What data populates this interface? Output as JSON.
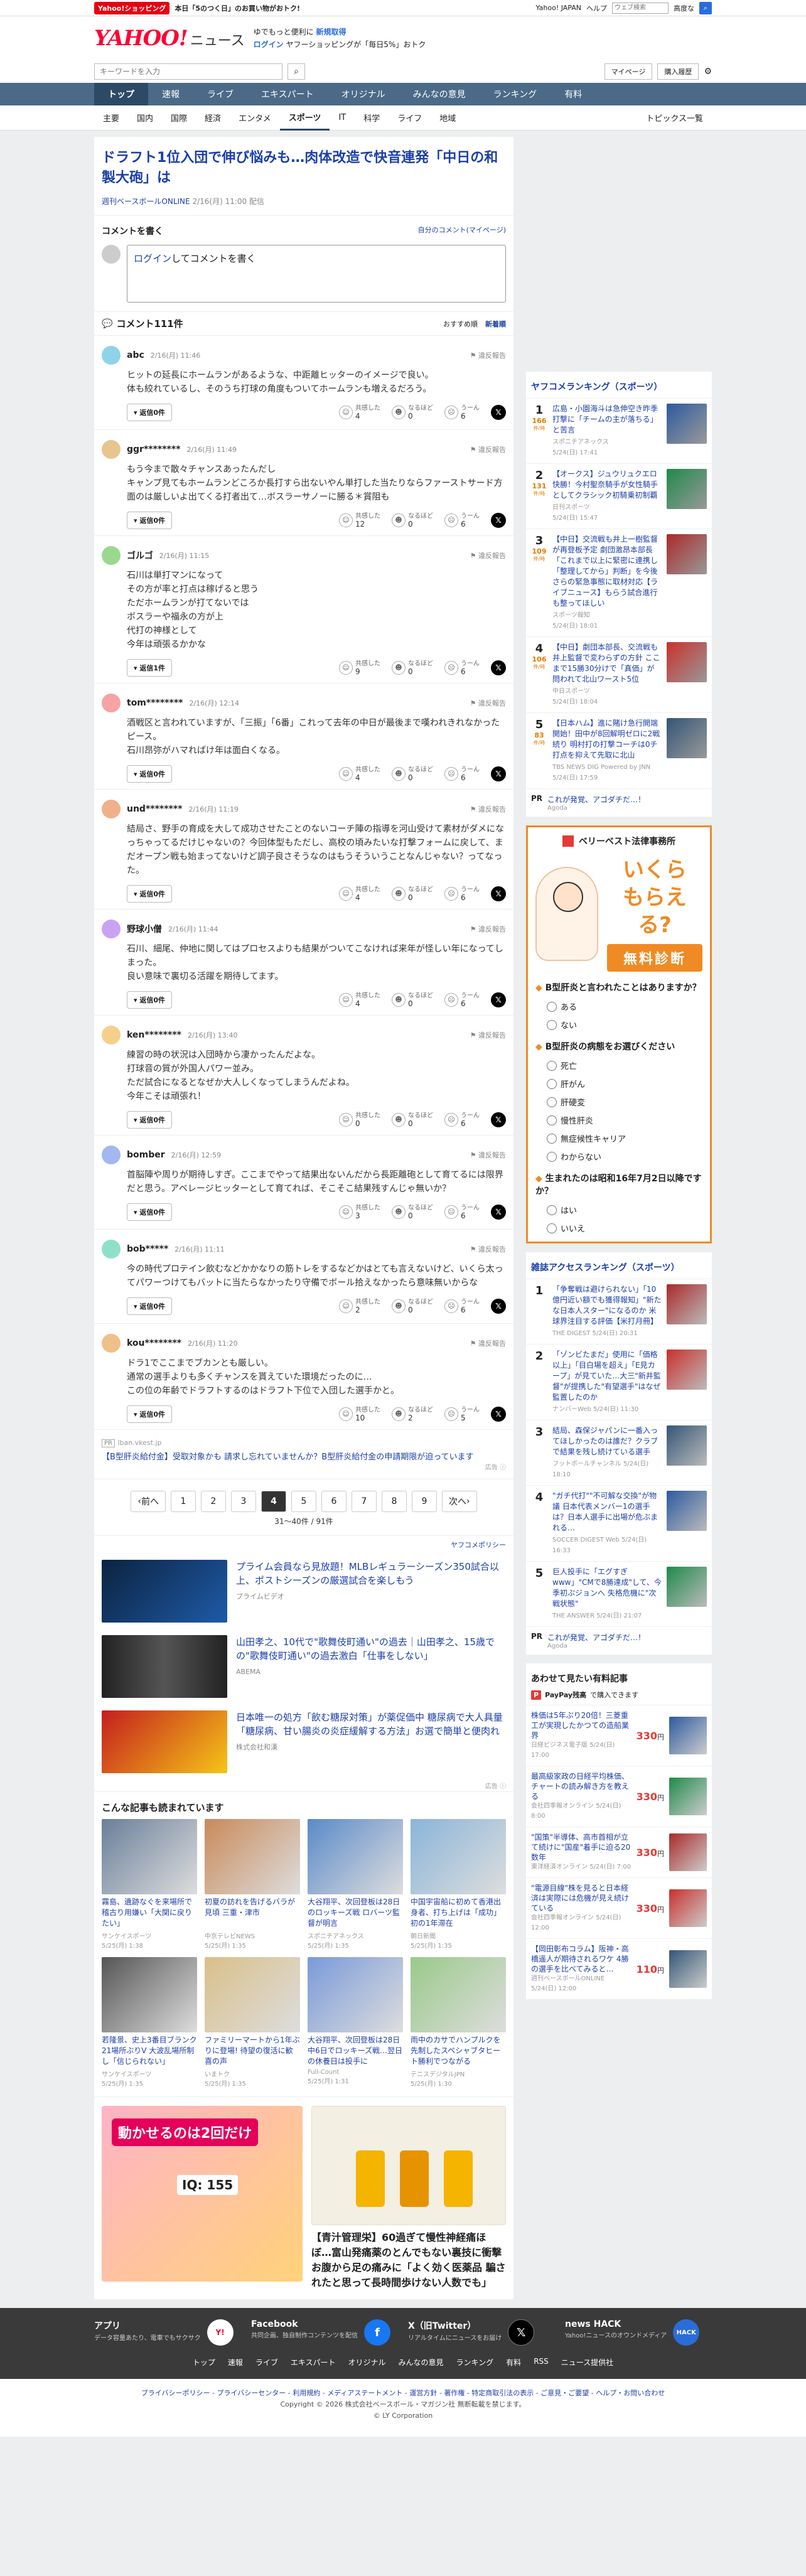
{
  "topbar": {
    "shop": "Yahoo!ショッピング",
    "promo": "本日「5のつく日」のお買い物がおトク!",
    "yjapan": "Yahoo! JAPAN",
    "help": "ヘルプ",
    "search_placeholder": "ウェブ検索",
    "adv": "高度な"
  },
  "brand": {
    "logo": "YAHOO!",
    "sub": "ニュース",
    "promo_line1": "ゆでもっと便利に",
    "new_reg": "新規取得",
    "login": "ログイン",
    "promo_line2": "ヤフーショッピングが「毎日5%」おトク"
  },
  "search": {
    "placeholder": "キーワードを入力",
    "mypage": "マイページ",
    "subscribe": "購入履歴"
  },
  "gnav": [
    "トップ",
    "速報",
    "ライブ",
    "エキスパート",
    "オリジナル",
    "みんなの意見",
    "ランキング",
    "有料"
  ],
  "snav": [
    "主要",
    "国内",
    "国際",
    "経済",
    "エンタメ",
    "スポーツ",
    "IT",
    "科学",
    "ライフ",
    "地域"
  ],
  "snav_right": "トピックス一覧",
  "article": {
    "title": "ドラフト1位入団で伸び悩みも…肉体改造で快音連発「中日の和製大砲」は",
    "source": "週刊ベースボールONLINE",
    "date": "2/16(月) 11:00",
    "delivered": "配信"
  },
  "comment_box": {
    "heading": "コメントを書く",
    "my_comments": "自分のコメント(マイページ)",
    "login": "ログイン",
    "prompt": "してコメントを書く"
  },
  "comments_head": {
    "title": "コメント111件",
    "sort1": "おすすめ順",
    "sort2": "新着順"
  },
  "reaction_labels": [
    "共感した",
    "なるほど",
    "うーん"
  ],
  "reply_suffix": "返信",
  "report": "違反報告",
  "comments": [
    {
      "user": "abc",
      "date": "2/16(月) 11:46",
      "body": "ヒットの延長にホームランがあるような、中距離ヒッターのイメージで良い。\n体も絞れているし、そのうち打球の角度もついてホームランも増えるだろう。",
      "replies": "返信0件",
      "r": [
        4,
        0,
        6
      ]
    },
    {
      "user": "ggr********",
      "date": "2/16(月) 11:49",
      "body": "もう今まで散々チャンスあったんだし\nキャンプ見てもホームランどころか長打すら出ないやん単打した当たりならファーストサード方面のは厳しいよ出てくる打者出て…ボスラーサノーに勝る＊賞阻も",
      "replies": "返信0件",
      "r": [
        12,
        0,
        6
      ]
    },
    {
      "user": "ゴルゴ",
      "date": "2/16(月) 11:15",
      "body": "石川は単打マンになって\nその方が率と打点は稼げると思う\nただホームランが打てないでは\nボスラーや福永の方が上\n代打の神様として\n今年は頑張るかかな",
      "replies": "返信1件",
      "r": [
        9,
        0,
        6
      ]
    },
    {
      "user": "tom********",
      "date": "2/16(月) 12:14",
      "body": "酒戦区と言われていますが、「三振」「6番」これって去年の中日が最後まで嘆われきれなかったピース。\n石川昂弥がハマればけ年は面白くなる。",
      "replies": "返信0件",
      "r": [
        4,
        0,
        6
      ]
    },
    {
      "user": "und********",
      "date": "2/16(月) 11:19",
      "body": "結局さ、野手の育成を大して成功させたことのないコーチ陣の指導を河山受けて素材がダメになっちゃってるだけじゃないの？今回体型もただし、高校の頃みたいな打撃フォームに戻して、まだオープン戦も始まってないけど調子良さそうなのはもうそういうことなんじゃない？ってなった。",
      "replies": "返信0件",
      "r": [
        4,
        0,
        6
      ]
    },
    {
      "user": "野球小僧",
      "date": "2/16(月) 11:44",
      "body": "石川、細尾、仲地に関してはプロセスよりも結果がついてこなければ来年が怪しい年になってしまった。\n良い意味で裏切る活躍を期待してます。",
      "replies": "返信0件",
      "r": [
        4,
        0,
        6
      ]
    },
    {
      "user": "ken********",
      "date": "2/16(月) 13:40",
      "body": "練習の時の状況は入団時から凄かったんだよな。\n打球音の質が外国人パワー並み。\nただ試合になるとなぜか大人しくなってしまうんだよね。\n今年こそは頑張れ！",
      "replies": "返信0件",
      "r": [
        0,
        0,
        6
      ]
    },
    {
      "user": "bomber",
      "date": "2/16(月) 12:59",
      "body": "首脳陣や周りが期待しすぎ。ここまでやって結果出ないんだから長距離砲として育てるには限界だと思う。アベレージヒッターとして育てれば、そこそこ結果残すんじゃ無いか？",
      "replies": "返信0件",
      "r": [
        3,
        0,
        6
      ]
    },
    {
      "user": "bob*****",
      "date": "2/16(月) 11:11",
      "body": "今の時代プロテイン飲むなどかかなりの筋トレをするなどかはとても言えないけど、いくら太ってパワーつけてもバットに当たらなかったり守備でボール拾えなかったら意味無いからな",
      "replies": "返信0件",
      "r": [
        2,
        0,
        6
      ]
    },
    {
      "user": "kou********",
      "date": "2/16(月) 11:20",
      "body": "ドラ1でここまでブカンとも厳しい。\n通常の選手よりも多くチャンスを貰えていた環境だったのに…\nこの位の年齢でドラフトするのはドラフト下位で入団した選手かと。",
      "replies": "返信0件",
      "r": [
        10,
        2,
        5
      ]
    }
  ],
  "ad_line": {
    "src": "lban.vkest.jp",
    "text": "【B型肝炎給付金】受取対象かも 請求し忘れていませんか？B型肝炎給付金の申請期限が迫っています",
    "pr": "広告"
  },
  "pager": {
    "prev": "前へ",
    "next": "次へ",
    "pages": [
      "1",
      "2",
      "3",
      "4",
      "5",
      "6",
      "7",
      "8",
      "9"
    ],
    "current": "4",
    "count": "31〜40件 / 91件"
  },
  "policy": "ヤフコメポリシー",
  "promos": [
    {
      "title": "プライム会員なら見放題！MLBレギュラーシーズン350試合以上、ポストシーズンの厳選試合を楽しもう",
      "src": "プライムビデオ"
    },
    {
      "title": "山田孝之、10代で\"歌舞伎町通い\"の過去｜山田孝之、15歳での\"歌舞伎町通い\"の過去激白「仕事をしない」",
      "src": "ABEMA"
    },
    {
      "title": "日本唯一の処方「飲む糖尿対策」が薬促価中 糖尿病で大人具量「糖尿病、甘い腸炎の炎症緩解する方法」お選で簡単と便肉れ",
      "src": "株式会社和漢"
    }
  ],
  "promo_ad_lbl": "広告",
  "read_title": "こんな記事も読まれています",
  "grid": [
    {
      "title": "霧島、遺跡なぐを来場所で稽古り用嫌い「大関に戻りたい」",
      "src": "サンケイスポーツ",
      "date": "5/25(月) 1:38"
    },
    {
      "title": "初夏の訪れを告げるバラが見頃 三重・津市",
      "src": "中京テレビNEWS",
      "date": "5/25(月) 1:35"
    },
    {
      "title": "大谷翔平、次回登板は28日のロッキーズ戦 ロバーツ監督が明言",
      "src": "スポニチアネックス",
      "date": "5/25(月) 1:35"
    },
    {
      "title": "中国宇宙船に初めて香港出身者、打ち上げは「成功」 初の1年滞在",
      "src": "朝日新聞",
      "date": "5/25(月) 1:35"
    },
    {
      "title": "若隆景、史上3番目ブランク21場所ぶりV 大波乱場所制し「信じられない」",
      "src": "サンケイスポーツ",
      "date": "5/25(月) 1:35"
    },
    {
      "title": "ファミリーマートから1年ぶりに登場! 待望の復活に歓喜の声",
      "src": "いまトク",
      "date": "5/25(月) 1:35"
    },
    {
      "title": "大谷翔平、次回登板は28日 中6日でロッキーズ戦…翌日の休養日は投手に",
      "src": "Full-Count",
      "date": "5/25(月) 1:31"
    },
    {
      "title": "雨中のカサでハンプルクを先制したスペシャブタヒート勝利でつながる",
      "src": "テニスデジタルJPN",
      "date": "5/25(月) 1:30"
    }
  ],
  "big_ad": {
    "left_b1": "動かせるのは2回だけ",
    "left_b2": "IQ: 155",
    "right_title": "【青汁管理栄】60過ぎて慢性神経痛ほぼ…富山発痛薬のとんでもない裏技に衝撃 お腹から足の痛みに「よく効く医薬品 騙されたと思って長時間歩けない人数でも」"
  },
  "footer": {
    "cards": [
      {
        "title": "アプリ",
        "desc": "データ容量あたり、電車でもサクサク"
      },
      {
        "title": "Facebook",
        "desc": "共同企画、独自制作コンテンツを配信",
        "icon": "f"
      },
      {
        "title": "X（旧Twitter）",
        "desc": "リアルタイムにニュースをお届け",
        "icon": "𝕏"
      },
      {
        "title": "news HACK",
        "desc": "Yahoo!ニュースのオウンドメディア",
        "icon": "HACK"
      }
    ],
    "links": [
      "トップ",
      "速報",
      "ライブ",
      "エキスパート",
      "オリジナル",
      "みんなの意見",
      "ランキング",
      "有料",
      "RSS",
      "ニュース提供社"
    ]
  },
  "legal": {
    "links": "プライバシーポリシー - プライバシーセンター - 利用規約 - メディアステートメント - 運営方針 - 著作権 - 特定商取引法の表示 - ご意見・ご要望 - ヘルプ・お問い合わせ",
    "copy": "Copyright © 2026 株式会社ベースボール・マガジン社 無断転載を禁じます。",
    "corp": "© LY Corporation"
  },
  "side_rank": {
    "title": "ヤフコメランキング（スポーツ）",
    "comments_label": "件/時",
    "items": [
      {
        "n": "1",
        "c": "166",
        "t": "広島・小園海斗は急伸空き昨季打撃に「チームの主が落ちる」と苦言",
        "s": "スポニチアネックス",
        "d": "5/24(日) 17:41"
      },
      {
        "n": "2",
        "c": "131",
        "t": "【オークス】ジュウリュクエロ快勝！今村聖奈騎手が女性騎手としてクラシック初騎乗初制覇",
        "s": "日刊スポーツ",
        "d": "5/24(日) 15:47"
      },
      {
        "n": "3",
        "c": "109",
        "t": "【中日】交流戦も井上一樹監督が再登板予定 劇団激昂本部長「これまで以上に緊密に連携し「整理してから」判断」を今後さらの緊急事態に取材対応【ライブニュース】もらう試合進行も整ってほしい",
        "s": "スポーツ報知",
        "d": "5/24(日) 18:01"
      },
      {
        "n": "4",
        "c": "106",
        "t": "【中日】劇団本部長、交流戦も井上監督で変わらずの方針 ここまで15勝30分けで「真価」が問われて北山ワースト5位",
        "s": "中日スポーツ",
        "d": "5/24(日) 18:04"
      },
      {
        "n": "5",
        "c": "83",
        "t": "【日本ハム】進に賭け急行開端開始！田中が8回解明ゼロに2戦続り 明村打の打撃コーチは0チ打点を抑えて先取に北山",
        "s": "TBS NEWS DIG Powered by JNN",
        "d": "5/24(日) 17:59"
      }
    ]
  },
  "side_pr": {
    "title": "これが発覚、アゴダチだ…！",
    "src": "Agoda",
    "pr": "PR"
  },
  "quiz": {
    "law": "ベリーベスト法律事務所",
    "hl1": "いくら",
    "hl2": "もらえる?",
    "free": "無料診断",
    "q1": "B型肝炎と言われたことはありますか？",
    "o1": [
      "ある",
      "ない"
    ],
    "q2": "B型肝炎の病態をお選びください",
    "o2": [
      "死亡",
      "肝がん",
      "肝硬変",
      "慢性肝炎",
      "無症候性キャリア",
      "わからない"
    ],
    "q3": "生まれたのは昭和16年7月2日以降ですか？",
    "o3": [
      "はい",
      "いいえ"
    ]
  },
  "side_access": {
    "title": "雑誌アクセスランキング（スポーツ）",
    "items": [
      {
        "n": "1",
        "t": "「争奪戦は避けられない」「10億円近い額でも獲得報知」\"新たな日本人スター\"になるのか 米球界注目する評価【米打月冊】",
        "s": "THE DIGEST",
        "d": "5/24(日) 20:31"
      },
      {
        "n": "2",
        "t": "「ゾンビたまだ」使用に「価格以上」「目白場を超え」「E見カープ」が見ていた…大三\"新井監督\"が提携した\"有望選手\"はなぜ監置したのか",
        "s": "ナンバーWeb",
        "d": "5/24(日) 11:30"
      },
      {
        "n": "3",
        "t": "結局、森保ジャパンに一番入ってほしかったのは誰だ？クラブで結果を残し続けている選手",
        "s": "フットボールチャンネル",
        "d": "5/24(日) 18:10"
      },
      {
        "n": "4",
        "t": "\"ガチ代打\"\"不可解な交換\"が物議 日本代表メンバー1の選手は？日本人選手に出場が危ぶまれる…",
        "s": "SOCCER DIGEST Web",
        "d": "5/24(日) 16:33"
      },
      {
        "n": "5",
        "t": "巨人投手に「エグすぎwww」\"CMで8勝達成\"して、今季初ぷジョンへ 失格危機に\"次戦状態\"",
        "s": "THE ANSWER",
        "d": "5/24(日) 21:07"
      }
    ]
  },
  "side_pr2": {
    "title": "これが発覚、アゴダチだ…！",
    "src": "Agoda",
    "pr": "PR"
  },
  "side_shop": {
    "title": "あわせて見たい有料記事",
    "svc": "PayPay残高",
    "svc_desc": "で購入できます",
    "items": [
      {
        "t": "株価は5年ぶり20倍！三菱重工が実現したかつての造船業界",
        "s": "日経ビジネス電子版",
        "d": "5/24(日) 17:00",
        "p": "330"
      },
      {
        "t": "最高級家政の日経平均株価、チャートの読み解き方を教える",
        "s": "会社四季報オンライン",
        "d": "5/24(日) 8:00",
        "p": "330"
      },
      {
        "t": "\"国策\"半導体、高市首相が立て続けに\"国産\"着手に迫る20数年",
        "s": "東洋経済オンライン",
        "d": "5/24(日) 7:00",
        "p": "330"
      },
      {
        "t": "\"電源目線\"株を見ると日本経済は実際には危機が見え続けている",
        "s": "会社四季報オンライン",
        "d": "5/24(日) 12:00",
        "p": "330"
      },
      {
        "t": "【岡田彰布コラム】阪神・高橋遥人が期待されるワケ 4勝の選手を比べてみると…",
        "s": "週刊ベースボールONLINE",
        "d": "5/24(日) 12:00",
        "p": "110"
      }
    ]
  }
}
